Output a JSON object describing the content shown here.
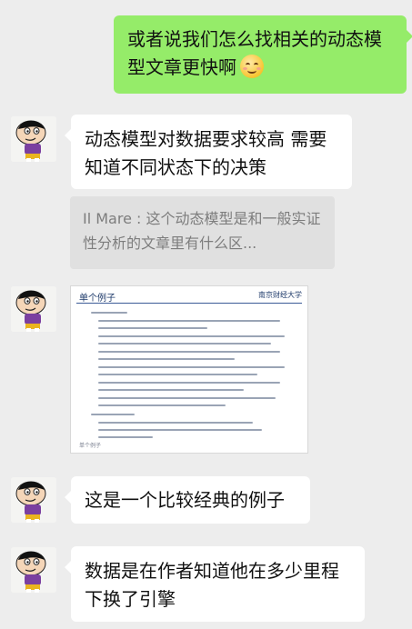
{
  "messages": [
    {
      "side": "right",
      "text": "或者说我们怎么找相关的动态模型文章更快啊",
      "emoji": "smiling-face-icon"
    },
    {
      "side": "left",
      "text": "动态模型对数据要求较高 需要知道不同状态下的决策"
    },
    {
      "side": "left",
      "type": "quote",
      "text": "Il Mare : 这个动态模型是和一般实证性分析的文章里有什么区..."
    },
    {
      "side": "left",
      "type": "image",
      "slide": {
        "title": "单个例子",
        "logo": "南京财经大学",
        "footer": "单个例子"
      }
    },
    {
      "side": "left",
      "text": "这是一个比较经典的例子"
    },
    {
      "side": "left",
      "text": "数据是在作者知道他在多少里程下换了引擎"
    }
  ],
  "colors": {
    "background": "#ededed",
    "sent_bubble": "#95ec69",
    "received_bubble": "#ffffff",
    "quote_bg": "#e0e0e0"
  }
}
